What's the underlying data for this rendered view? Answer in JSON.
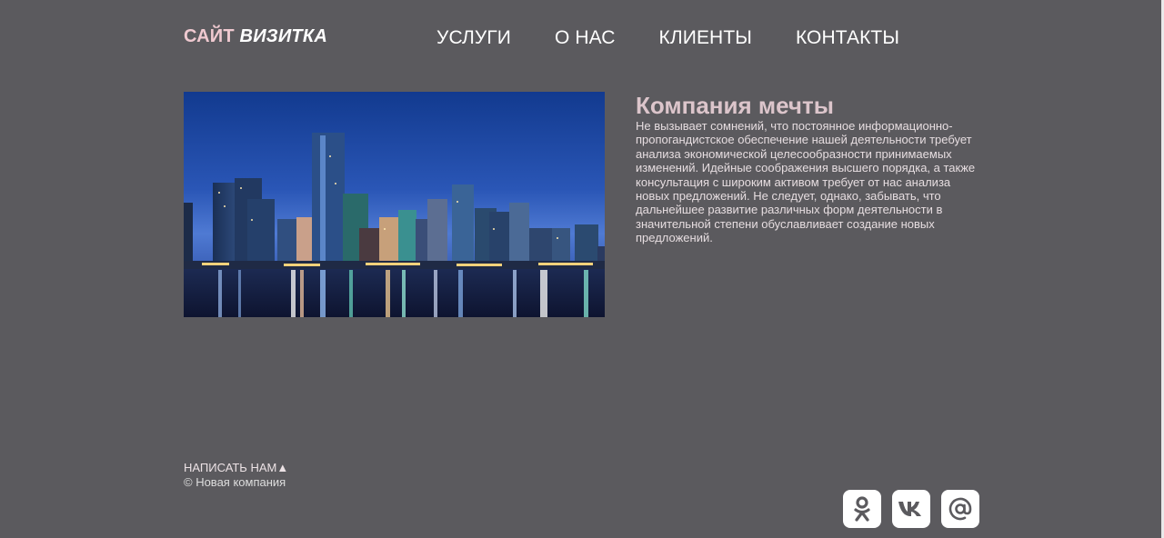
{
  "header": {
    "logo_part1": "САЙТ",
    "logo_part2": "ВИЗИТКА",
    "nav": [
      "УСЛУГИ",
      "О НАС",
      "КЛИЕНТЫ",
      "КОНТАКТЫ"
    ]
  },
  "main": {
    "image_icon": "city-skyline-image",
    "title": "Компания мечты",
    "text": "Не вызывает сомнений, что постоянное информационно-пропогандистское обеспечение нашей деятельности требует анализа экономической целесообразности принимаемых изменений. Идейные соображения высшего порядка, а также консультация с широким активом требует от нас анализа новых предложений. Не следует, однако, забывать, что дальнейшее развитие различных форм деятельности в значительной степени обуславливает создание новых предложений."
  },
  "footer": {
    "write_us": "НАПИСАТЬ НАМ▲",
    "copyright": "© Новая компания",
    "socials": [
      "odnoklassniki-icon",
      "vk-icon",
      "mail-at-icon"
    ]
  },
  "colors": {
    "background": "#5b5a5e",
    "logo_accent": "#efc9d0",
    "title": "#dcc5cb"
  }
}
